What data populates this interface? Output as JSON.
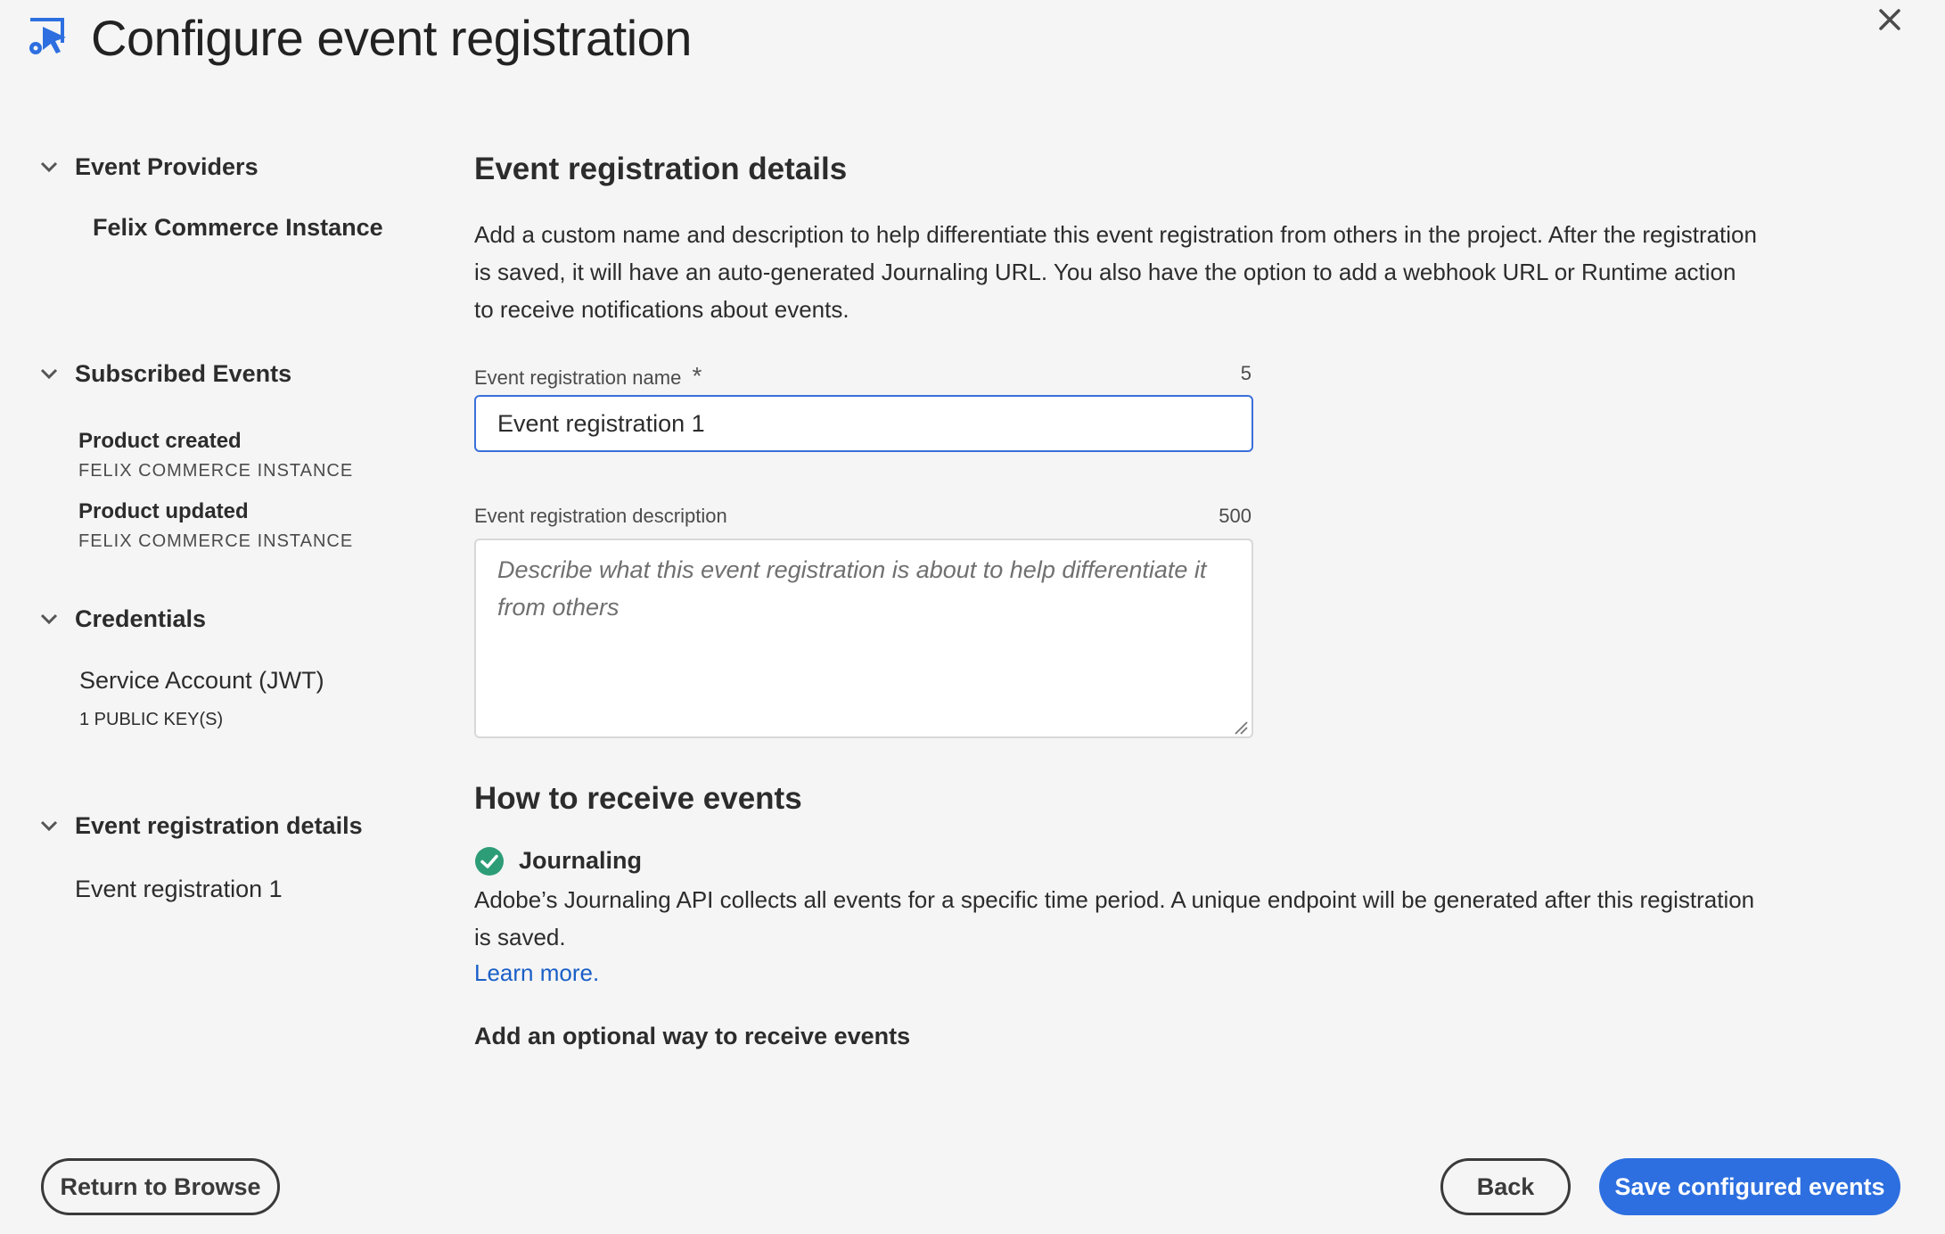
{
  "header": {
    "title": "Configure event registration",
    "app_icon": "event-config-icon",
    "close_icon": "close-icon"
  },
  "sidebar": {
    "event_providers": {
      "heading": "Event Providers",
      "items": [
        "Felix Commerce Instance"
      ]
    },
    "subscribed_events": {
      "heading": "Subscribed Events",
      "items": [
        {
          "name": "Product created",
          "provider": "FELIX COMMERCE INSTANCE"
        },
        {
          "name": "Product updated",
          "provider": "FELIX COMMERCE INSTANCE"
        }
      ]
    },
    "credentials": {
      "heading": "Credentials",
      "name": "Service Account (JWT)",
      "detail": "1 PUBLIC KEY(S)"
    },
    "registration_details": {
      "heading": "Event registration details",
      "value": "Event registration 1"
    }
  },
  "main": {
    "details_heading": "Event registration details",
    "details_paragraph": "Add a custom name and description to help differentiate this event registration from others in the project. After the registration is saved, it will have an auto-generated Journaling URL. You also have the option to add a webhook URL or Runtime action to receive notifications about events.",
    "name_field": {
      "label": "Event registration name",
      "required_marker": "*",
      "counter": "5",
      "value": "Event registration 1"
    },
    "description_field": {
      "label": "Event registration description",
      "counter": "500",
      "placeholder": "Describe what this event registration is about to help differentiate it from others",
      "value": ""
    },
    "receive_heading": "How to receive events",
    "journaling": {
      "title": "Journaling",
      "description": "Adobe’s Journaling API collects all events for a specific time period. A unique endpoint will be generated after this registration is saved.",
      "learn_more": "Learn more."
    },
    "optional_heading": "Add an optional way to receive events"
  },
  "footer": {
    "return_label": "Return to Browse",
    "back_label": "Back",
    "save_label": "Save configured events"
  },
  "colors": {
    "accent": "#2d6fe0",
    "focus_border": "#3a6fd8",
    "success": "#2d9d78",
    "link": "#1a5fc7",
    "background": "#f5f5f5"
  }
}
